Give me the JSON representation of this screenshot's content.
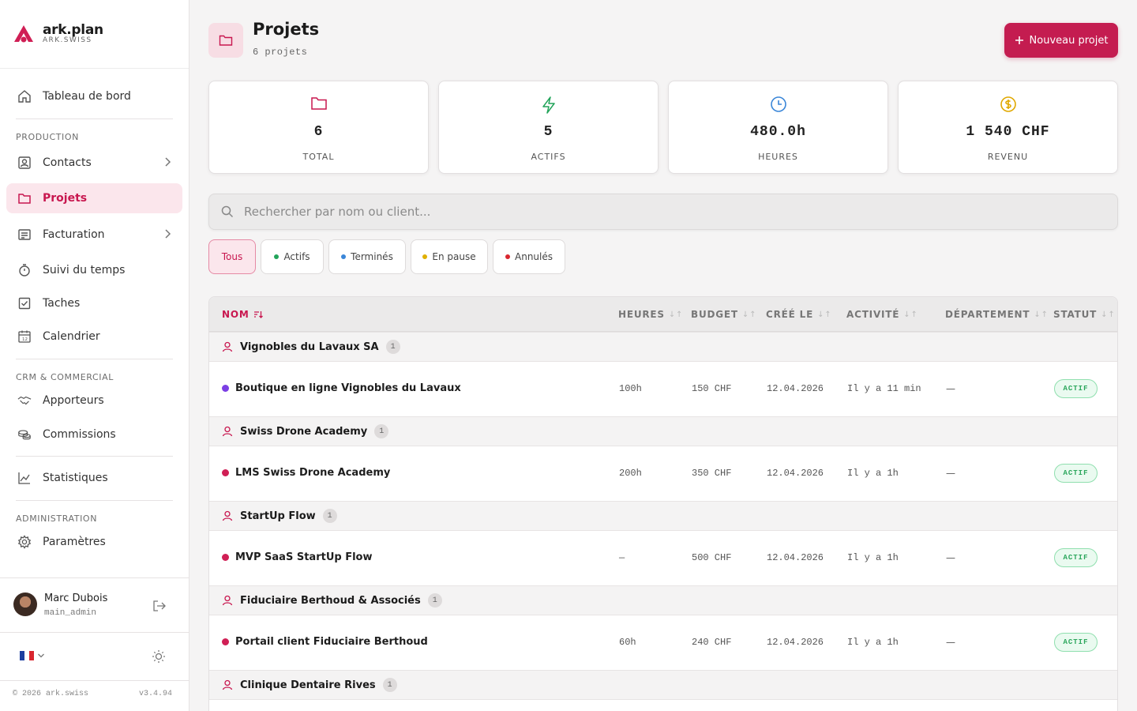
{
  "brand": {
    "name": "ark.plan",
    "sub": "ARK.SWISS"
  },
  "nav": {
    "dashboard": "Tableau de bord",
    "section_production": "PRODUCTION",
    "contacts": "Contacts",
    "projects": "Projets",
    "billing": "Facturation",
    "time": "Suivi du temps",
    "tasks": "Taches",
    "calendar": "Calendrier",
    "section_crm": "CRM & COMMERCIAL",
    "referrers": "Apporteurs",
    "commissions": "Commissions",
    "stats": "Statistiques",
    "section_admin": "ADMINISTRATION",
    "settings": "Paramètres"
  },
  "user": {
    "name": "Marc Dubois",
    "role": "main_admin"
  },
  "footer": {
    "copyright": "© 2026 ark.swiss",
    "version": "v3.4.94"
  },
  "header": {
    "title": "Projets",
    "subtitle": "6 projets",
    "new_button": "Nouveau projet"
  },
  "stats": [
    {
      "value": "6",
      "label": "TOTAL",
      "icon": "folder-icon",
      "color": "#c8174f"
    },
    {
      "value": "5",
      "label": "ACTIFS",
      "icon": "bolt-icon",
      "color": "#22a45a"
    },
    {
      "value": "480.0h",
      "label": "HEURES",
      "icon": "clock-icon",
      "color": "#3a86d8"
    },
    {
      "value": "1 540 CHF",
      "label": "REVENU",
      "icon": "coin-icon",
      "color": "#e0a800"
    }
  ],
  "search": {
    "placeholder": "Rechercher par nom ou client..."
  },
  "filters": [
    {
      "label": "Tous",
      "dot": null
    },
    {
      "label": "Actifs",
      "dot": "#22a45a"
    },
    {
      "label": "Terminés",
      "dot": "#3a86d8"
    },
    {
      "label": "En pause",
      "dot": "#e0b000"
    },
    {
      "label": "Annulés",
      "dot": "#d9262f"
    }
  ],
  "table": {
    "columns": {
      "name": "NOM",
      "hours": "HEURES",
      "budget": "BUDGET",
      "created": "CRÉÉ LE",
      "activity": "ACTIVITÉ",
      "department": "DÉPARTEMENT",
      "status": "STATUT"
    },
    "groups": [
      {
        "client": "Vignobles du Lavaux SA",
        "count": "1",
        "project": {
          "name": "Boutique en ligne Vignobles du Lavaux",
          "color": "#7b3fe4",
          "hours": "100h",
          "budget": "150 CHF",
          "created": "12.04.2026",
          "activity": "Il y a 11 min",
          "department": "—",
          "status": "ACTIF"
        }
      },
      {
        "client": "Swiss Drone Academy",
        "count": "1",
        "project": {
          "name": "LMS Swiss Drone Academy",
          "color": "#d01f55",
          "hours": "200h",
          "budget": "350 CHF",
          "created": "12.04.2026",
          "activity": "Il y a 1h",
          "department": "—",
          "status": "ACTIF"
        }
      },
      {
        "client": "StartUp Flow",
        "count": "1",
        "project": {
          "name": "MVP SaaS StartUp Flow",
          "color": "#d01f55",
          "hours": "—",
          "budget": "500 CHF",
          "created": "12.04.2026",
          "activity": "Il y a 1h",
          "department": "—",
          "status": "ACTIF"
        }
      },
      {
        "client": "Fiduciaire Berthoud & Associés",
        "count": "1",
        "project": {
          "name": "Portail client Fiduciaire Berthoud",
          "color": "#d01f55",
          "hours": "60h",
          "budget": "240 CHF",
          "created": "12.04.2026",
          "activity": "Il y a 1h",
          "department": "—",
          "status": "ACTIF"
        }
      },
      {
        "client": "Clinique Dentaire Rives",
        "count": "1"
      }
    ]
  }
}
